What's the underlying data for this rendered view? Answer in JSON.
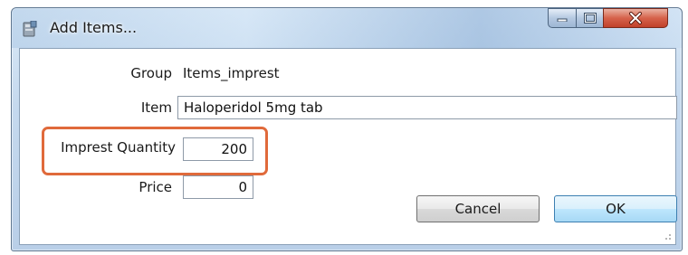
{
  "window": {
    "title": "Add Items...",
    "icons": {
      "app": "app-icon",
      "minimize": "minimize-icon",
      "maximize": "maximize-icon",
      "close": "close-icon"
    }
  },
  "form": {
    "group_label": "Group",
    "group_value": "Items_imprest",
    "item_label": "Item",
    "item_value": "Haloperidol 5mg tab",
    "quantity_label": "Imprest Quantity",
    "quantity_value": "200",
    "price_label": "Price",
    "price_value": "0"
  },
  "buttons": {
    "cancel_label": "Cancel",
    "ok_label": "OK"
  },
  "colors": {
    "highlight": "#e06a3b",
    "close_button": "#d6624b"
  }
}
